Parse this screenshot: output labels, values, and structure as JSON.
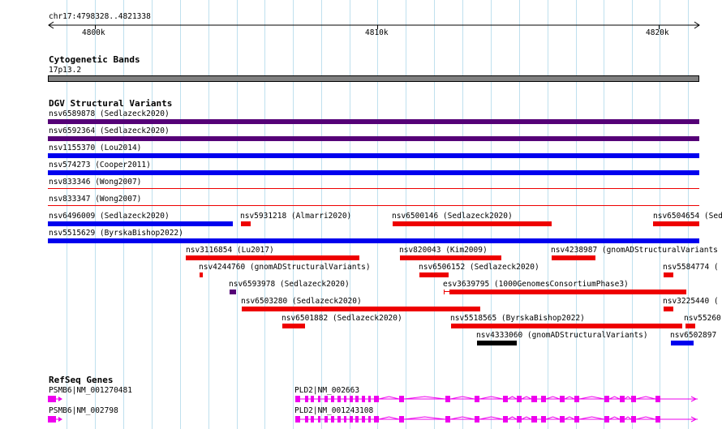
{
  "ruler": {
    "location": "chr17:4798328..4821338",
    "ticks": [
      "4800k",
      "4810k",
      "4820k"
    ]
  },
  "cytoband": {
    "title": "Cytogenetic Bands",
    "band_label": "17p13.2",
    "band_color": "#808080"
  },
  "dgv": {
    "title": "DGV Structural Variants",
    "colors": {
      "loss": "#ee0000",
      "gain": "#0000ee",
      "complex": "#550077",
      "other": "#000000"
    },
    "features": [
      {
        "label": "nsv6589878 (Sedlazeck2020)",
        "type": "complex"
      },
      {
        "label": "nsv6592364 (Sedlazeck2020)",
        "type": "complex"
      },
      {
        "label": "nsv1155370 (Lou2014)",
        "type": "gain"
      },
      {
        "label": "nsv574273 (Cooper2011)",
        "type": "gain"
      },
      {
        "label": "nsv833346 (Wong2007)",
        "type": "loss"
      },
      {
        "label": "nsv833347 (Wong2007)",
        "type": "loss"
      },
      {
        "label": "nsv6496009 (Sedlazeck2020)",
        "type": "gain"
      },
      {
        "label": "nsv5931218 (Almarri2020)",
        "type": "loss"
      },
      {
        "label": "nsv6500146 (Sedlazeck2020)",
        "type": "loss"
      },
      {
        "label": "nsv6504654 (Sed",
        "type": "loss"
      },
      {
        "label": "nsv5515629 (ByrskaBishop2022)",
        "type": "gain"
      },
      {
        "label": "nsv3116854 (Lu2017)",
        "type": "loss"
      },
      {
        "label": "nsv820043 (Kim2009)",
        "type": "loss"
      },
      {
        "label": "nsv4238987 (gnomADStructuralVariants",
        "type": "loss"
      },
      {
        "label": "nsv4244760 (gnomADStructuralVariants)",
        "type": "loss"
      },
      {
        "label": "nsv6506152 (Sedlazeck2020)",
        "type": "loss"
      },
      {
        "label": "nsv5584774 (",
        "type": "loss"
      },
      {
        "label": "nsv6593978 (Sedlazeck2020)",
        "type": "complex"
      },
      {
        "label": "esv3639795 (1000GenomesConsortiumPhase3)",
        "type": "loss"
      },
      {
        "label": "nsv6503280 (Sedlazeck2020)",
        "type": "loss"
      },
      {
        "label": "nsv3225440 (",
        "type": "loss"
      },
      {
        "label": "nsv6501882 (Sedlazeck2020)",
        "type": "loss"
      },
      {
        "label": "nsv5518565 (ByrskaBishop2022)",
        "type": "loss"
      },
      {
        "label": "nsv55260",
        "type": "loss"
      },
      {
        "label": "nsv4333060 (gnomADStructuralVariants)",
        "type": "other"
      },
      {
        "label": "nsv6502897",
        "type": "gain"
      }
    ]
  },
  "refseq": {
    "title": "RefSeq Genes",
    "color": "#ee00ee",
    "genes": [
      {
        "label": "PSMB6|NM_001270481"
      },
      {
        "label": "PLD2|NM_002663"
      },
      {
        "label": "PSMB6|NM_002798"
      },
      {
        "label": "PLD2|NM_001243108"
      }
    ]
  }
}
